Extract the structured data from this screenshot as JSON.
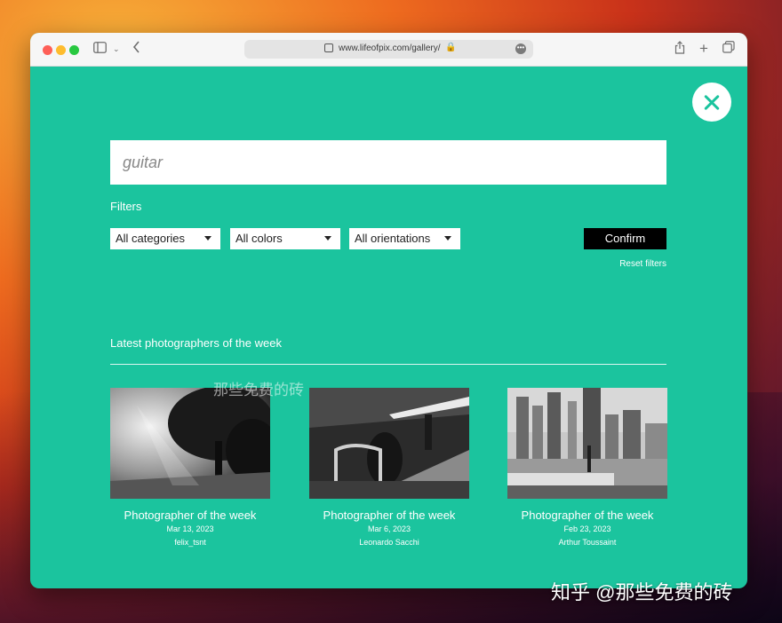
{
  "browser": {
    "url": "www.lifeofpix.com/gallery/",
    "icons": [
      "sidebar-icon",
      "chevron-down-icon",
      "back-icon",
      "share-icon",
      "plus-icon",
      "tabs-icon",
      "lock-icon",
      "more-icon"
    ]
  },
  "search": {
    "value": "guitar"
  },
  "filters": {
    "label": "Filters",
    "categories": "All categories",
    "colors": "All colors",
    "orientations": "All orientations",
    "confirm": "Confirm",
    "reset": "Reset filters"
  },
  "section": {
    "title": "Latest photographers of the week"
  },
  "cards": [
    {
      "title": "Photographer of the week",
      "date": "Mar 13, 2023",
      "name": "felix_tsnt"
    },
    {
      "title": "Photographer of the week",
      "date": "Mar 6, 2023",
      "name": "Leonardo Sacchi"
    },
    {
      "title": "Photographer of the week",
      "date": "Feb 23, 2023",
      "name": "Arthur Toussaint"
    }
  ],
  "watermark": {
    "mid": "那些免费的砖",
    "corner": "知乎 @那些免费的砖"
  },
  "colors": {
    "accent": "#1bc49e",
    "button": "#000000"
  }
}
